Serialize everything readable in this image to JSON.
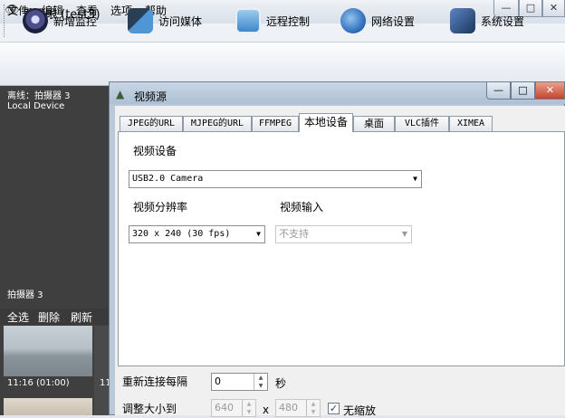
{
  "window": {
    "title": "千里眼 (test3)",
    "controls": {
      "minimize": "—",
      "maximize": "□",
      "close": "✕"
    }
  },
  "menu": [
    "文件",
    "编辑",
    "查看",
    "选项",
    "帮助"
  ],
  "toolbar": {
    "buttons": [
      {
        "label": "新增监控",
        "icon": "webcam-icon",
        "color": "#3a3f6b"
      },
      {
        "label": "访问媒体",
        "icon": "media-icon",
        "color": "#2f6fb0"
      },
      {
        "label": "远程控制",
        "icon": "remote-control-icon",
        "color": "#3d87c9"
      },
      {
        "label": "网络设置",
        "icon": "network-settings-icon",
        "color": "#2a66b5"
      },
      {
        "label": "系统设置",
        "icon": "system-settings-icon",
        "color": "#2d4c7a"
      }
    ]
  },
  "left_panel": {
    "status": "离线：拍摄器 3",
    "device": "Local Device",
    "list_label": "拍摄器 3",
    "list_actions": [
      "全选",
      "删除",
      "刷新"
    ],
    "thumbnails": [
      {
        "time": "11:16 (01:00)"
      },
      {
        "time": "11"
      }
    ]
  },
  "dialog": {
    "title": "视频源",
    "controls": {
      "minimize": "—",
      "maximize": "□",
      "close": "✕"
    },
    "tabs": [
      "JPEG的URL",
      "MJPEG的URL",
      "FFMPEG",
      "本地设备",
      "桌面",
      "VLC插件",
      "XIMEA"
    ],
    "active_tab": "本地设备",
    "video_device": {
      "label": "视频设备",
      "value": "USB2.0 Camera"
    },
    "resolution": {
      "label": "视频分辨率",
      "value": "320 x 240 (30 fps)"
    },
    "video_input": {
      "label": "视频输入",
      "value": "不支持"
    },
    "reconnect": {
      "label": "重新连接每隔",
      "value": "0",
      "unit": "秒"
    },
    "resize": {
      "label": "调整大小到",
      "width": "640",
      "separator": "x",
      "height": "480",
      "no_scale_label": "无缩放",
      "no_scale_checked": true
    }
  }
}
